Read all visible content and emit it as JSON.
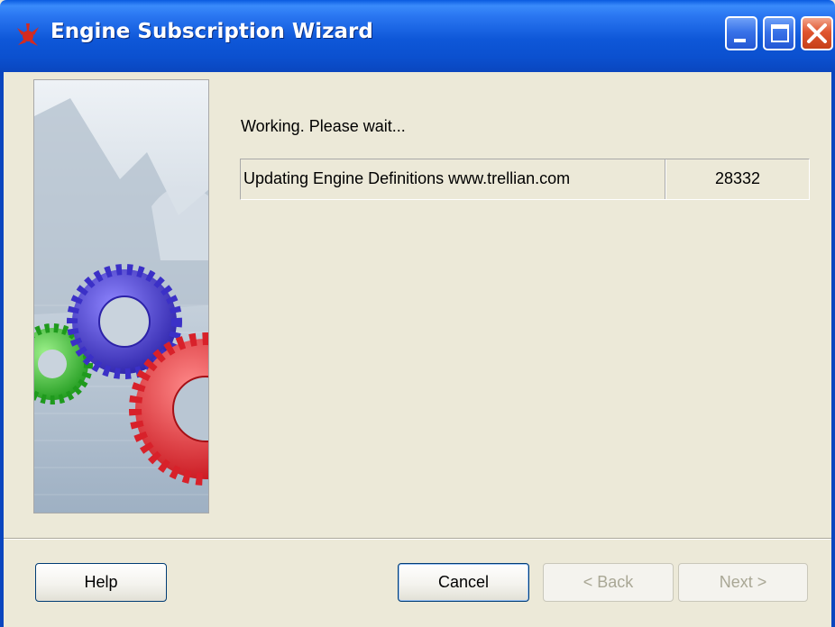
{
  "window": {
    "title": "Engine Subscription Wizard"
  },
  "main": {
    "status": "Working. Please wait...",
    "progress": {
      "label": "Updating Engine Definitions www.trellian.com",
      "count": "28332"
    }
  },
  "footer": {
    "help_label": "Help",
    "cancel_label": "Cancel",
    "back_label": "< Back",
    "next_label": "Next >"
  },
  "icons": {
    "title": "app-logo-icon",
    "minimize": "minimize-icon",
    "maximize": "maximize-icon",
    "close": "close-icon"
  },
  "colors": {
    "titlebar": "#0b50cf",
    "window_bg": "#ece9d8",
    "gear_blue": "#4a3fd8",
    "gear_red": "#e8333a",
    "gear_green": "#3fc23a"
  }
}
